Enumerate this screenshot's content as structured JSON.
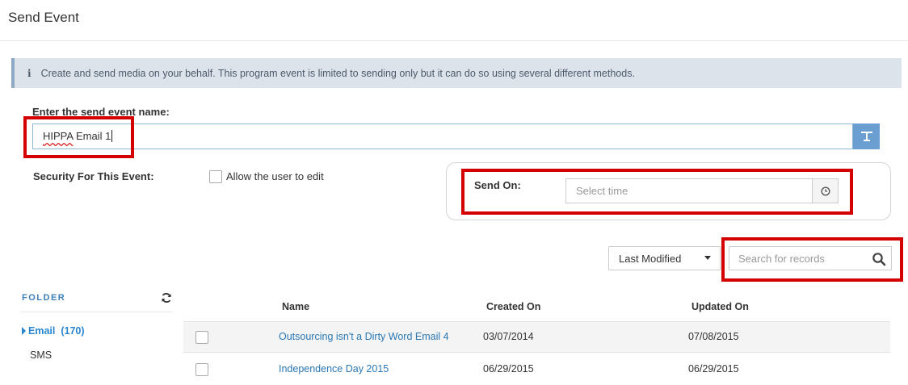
{
  "page": {
    "title": "Send Event"
  },
  "info": {
    "icon": "info-icon",
    "message": "Create and send media on your behalf. This program event is limited to sending only but it can do so using several different methods."
  },
  "name_field": {
    "label": "Enter the send event name:",
    "value_part1": "HIPPA",
    "value_part2": " Email 1",
    "button_icon": "text-format-icon"
  },
  "security": {
    "label": "Security For This Event:",
    "allow_edit_label": "Allow the user to edit",
    "allow_edit_checked": false
  },
  "send_on": {
    "label": "Send On:",
    "placeholder": "Select time",
    "button_icon": "clock-icon"
  },
  "toolbar": {
    "sort_selected": "Last Modified",
    "search_placeholder": "Search for records",
    "search_icon": "search-icon"
  },
  "folder": {
    "header": "FOLDER",
    "refresh_icon": "refresh-icon",
    "items": [
      {
        "label": "Email",
        "count": "(170)",
        "active": true
      },
      {
        "label": "SMS",
        "count": "",
        "active": false
      }
    ]
  },
  "table": {
    "columns": [
      "Name",
      "Created On",
      "Updated On"
    ],
    "rows": [
      {
        "name": "Outsourcing isn't a Dirty Word Email 4",
        "created": "03/07/2014",
        "updated": "07/08/2015"
      },
      {
        "name": "Independence Day 2015",
        "created": "06/29/2015",
        "updated": "06/29/2015"
      }
    ]
  },
  "colors": {
    "highlight_box": "#d40000",
    "accent": "#2a86d0",
    "info_bg": "#dde3ea"
  }
}
